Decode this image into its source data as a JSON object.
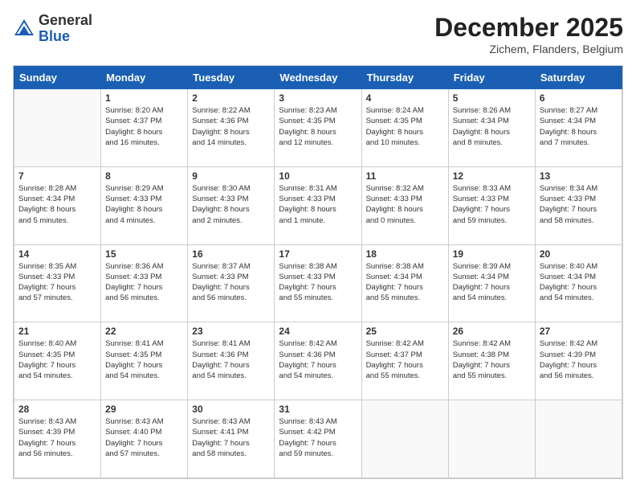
{
  "header": {
    "logo_line1": "General",
    "logo_line2": "Blue",
    "month_title": "December 2025",
    "subtitle": "Zichem, Flanders, Belgium"
  },
  "days_of_week": [
    "Sunday",
    "Monday",
    "Tuesday",
    "Wednesday",
    "Thursday",
    "Friday",
    "Saturday"
  ],
  "weeks": [
    [
      {
        "day": "",
        "info": ""
      },
      {
        "day": "1",
        "info": "Sunrise: 8:20 AM\nSunset: 4:37 PM\nDaylight: 8 hours\nand 16 minutes."
      },
      {
        "day": "2",
        "info": "Sunrise: 8:22 AM\nSunset: 4:36 PM\nDaylight: 8 hours\nand 14 minutes."
      },
      {
        "day": "3",
        "info": "Sunrise: 8:23 AM\nSunset: 4:35 PM\nDaylight: 8 hours\nand 12 minutes."
      },
      {
        "day": "4",
        "info": "Sunrise: 8:24 AM\nSunset: 4:35 PM\nDaylight: 8 hours\nand 10 minutes."
      },
      {
        "day": "5",
        "info": "Sunrise: 8:26 AM\nSunset: 4:34 PM\nDaylight: 8 hours\nand 8 minutes."
      },
      {
        "day": "6",
        "info": "Sunrise: 8:27 AM\nSunset: 4:34 PM\nDaylight: 8 hours\nand 7 minutes."
      }
    ],
    [
      {
        "day": "7",
        "info": "Sunrise: 8:28 AM\nSunset: 4:34 PM\nDaylight: 8 hours\nand 5 minutes."
      },
      {
        "day": "8",
        "info": "Sunrise: 8:29 AM\nSunset: 4:33 PM\nDaylight: 8 hours\nand 4 minutes."
      },
      {
        "day": "9",
        "info": "Sunrise: 8:30 AM\nSunset: 4:33 PM\nDaylight: 8 hours\nand 2 minutes."
      },
      {
        "day": "10",
        "info": "Sunrise: 8:31 AM\nSunset: 4:33 PM\nDaylight: 8 hours\nand 1 minute."
      },
      {
        "day": "11",
        "info": "Sunrise: 8:32 AM\nSunset: 4:33 PM\nDaylight: 8 hours\nand 0 minutes."
      },
      {
        "day": "12",
        "info": "Sunrise: 8:33 AM\nSunset: 4:33 PM\nDaylight: 7 hours\nand 59 minutes."
      },
      {
        "day": "13",
        "info": "Sunrise: 8:34 AM\nSunset: 4:33 PM\nDaylight: 7 hours\nand 58 minutes."
      }
    ],
    [
      {
        "day": "14",
        "info": "Sunrise: 8:35 AM\nSunset: 4:33 PM\nDaylight: 7 hours\nand 57 minutes."
      },
      {
        "day": "15",
        "info": "Sunrise: 8:36 AM\nSunset: 4:33 PM\nDaylight: 7 hours\nand 56 minutes."
      },
      {
        "day": "16",
        "info": "Sunrise: 8:37 AM\nSunset: 4:33 PM\nDaylight: 7 hours\nand 56 minutes."
      },
      {
        "day": "17",
        "info": "Sunrise: 8:38 AM\nSunset: 4:33 PM\nDaylight: 7 hours\nand 55 minutes."
      },
      {
        "day": "18",
        "info": "Sunrise: 8:38 AM\nSunset: 4:34 PM\nDaylight: 7 hours\nand 55 minutes."
      },
      {
        "day": "19",
        "info": "Sunrise: 8:39 AM\nSunset: 4:34 PM\nDaylight: 7 hours\nand 54 minutes."
      },
      {
        "day": "20",
        "info": "Sunrise: 8:40 AM\nSunset: 4:34 PM\nDaylight: 7 hours\nand 54 minutes."
      }
    ],
    [
      {
        "day": "21",
        "info": "Sunrise: 8:40 AM\nSunset: 4:35 PM\nDaylight: 7 hours\nand 54 minutes."
      },
      {
        "day": "22",
        "info": "Sunrise: 8:41 AM\nSunset: 4:35 PM\nDaylight: 7 hours\nand 54 minutes."
      },
      {
        "day": "23",
        "info": "Sunrise: 8:41 AM\nSunset: 4:36 PM\nDaylight: 7 hours\nand 54 minutes."
      },
      {
        "day": "24",
        "info": "Sunrise: 8:42 AM\nSunset: 4:36 PM\nDaylight: 7 hours\nand 54 minutes."
      },
      {
        "day": "25",
        "info": "Sunrise: 8:42 AM\nSunset: 4:37 PM\nDaylight: 7 hours\nand 55 minutes."
      },
      {
        "day": "26",
        "info": "Sunrise: 8:42 AM\nSunset: 4:38 PM\nDaylight: 7 hours\nand 55 minutes."
      },
      {
        "day": "27",
        "info": "Sunrise: 8:42 AM\nSunset: 4:39 PM\nDaylight: 7 hours\nand 56 minutes."
      }
    ],
    [
      {
        "day": "28",
        "info": "Sunrise: 8:43 AM\nSunset: 4:39 PM\nDaylight: 7 hours\nand 56 minutes."
      },
      {
        "day": "29",
        "info": "Sunrise: 8:43 AM\nSunset: 4:40 PM\nDaylight: 7 hours\nand 57 minutes."
      },
      {
        "day": "30",
        "info": "Sunrise: 8:43 AM\nSunset: 4:41 PM\nDaylight: 7 hours\nand 58 minutes."
      },
      {
        "day": "31",
        "info": "Sunrise: 8:43 AM\nSunset: 4:42 PM\nDaylight: 7 hours\nand 59 minutes."
      },
      {
        "day": "",
        "info": ""
      },
      {
        "day": "",
        "info": ""
      },
      {
        "day": "",
        "info": ""
      }
    ]
  ]
}
